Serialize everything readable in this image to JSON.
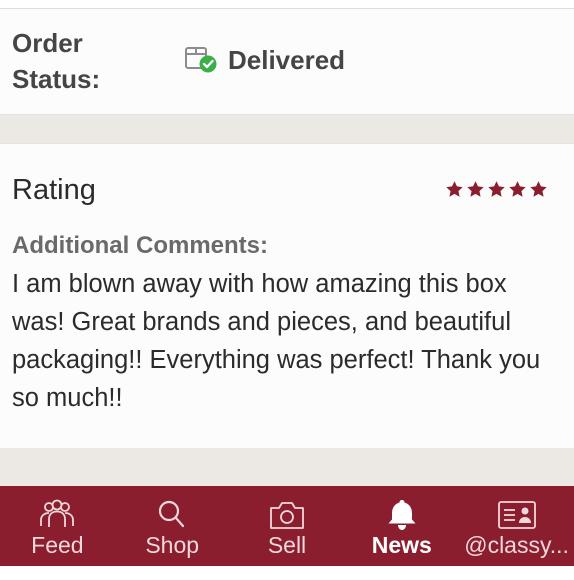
{
  "order_status": {
    "label": "Order Status:",
    "value": "Delivered",
    "icon": "delivered-box-check-icon"
  },
  "rating": {
    "title": "Rating",
    "stars": 5,
    "star_color": "#8b1e2e",
    "comments_label": "Additional Comments:",
    "comments_text": "I am blown away with how amazing this box was! Great brands and pieces, and beautiful packaging!! Everything was perfect! Thank you so much!!"
  },
  "tabbar": {
    "background": "#8b1e2e",
    "tabs": [
      {
        "label": "Feed",
        "icon": "people-icon",
        "active": false
      },
      {
        "label": "Shop",
        "icon": "search-icon",
        "active": false
      },
      {
        "label": "Sell",
        "icon": "camera-icon",
        "active": false
      },
      {
        "label": "News",
        "icon": "bell-icon",
        "active": true
      },
      {
        "label": "@classy...",
        "icon": "id-card-icon",
        "active": false
      }
    ]
  }
}
